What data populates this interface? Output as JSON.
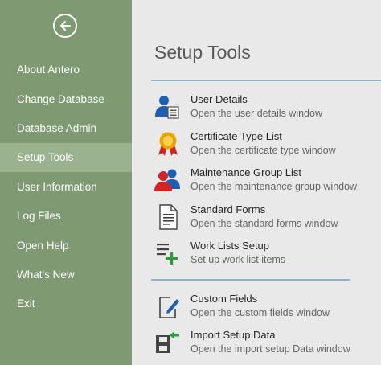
{
  "sidebar": {
    "items": [
      {
        "label": "About Antero"
      },
      {
        "label": "Change Database"
      },
      {
        "label": "Database Admin"
      },
      {
        "label": "Setup Tools"
      },
      {
        "label": "User Information"
      },
      {
        "label": "Log Files"
      },
      {
        "label": "Open Help"
      },
      {
        "label": "What's New"
      },
      {
        "label": "Exit"
      }
    ],
    "selected": "Setup Tools"
  },
  "main": {
    "title": "Setup Tools",
    "tools": [
      {
        "title": "User Details",
        "description": "Open the user details window",
        "icon": "user-details-icon"
      },
      {
        "title": "Certificate Type List",
        "description": "Open the certificate type window",
        "icon": "certificate-icon"
      },
      {
        "title": "Maintenance Group List",
        "description": "Open the maintenance group window",
        "icon": "maintenance-group-icon"
      },
      {
        "title": "Standard Forms",
        "description": "Open the standard forms window",
        "icon": "document-icon"
      },
      {
        "title": "Work Lists Setup",
        "description": "Set up work list items",
        "icon": "work-list-add-icon"
      },
      {
        "title": "Custom Fields",
        "description": "Open the custom fields window",
        "icon": "edit-document-icon"
      },
      {
        "title": "Import Setup Data",
        "description": "Open the import setup Data window",
        "icon": "import-icon"
      }
    ]
  },
  "colors": {
    "sidebar": "#7f9a73",
    "sidebar_selected": "#9bb28f",
    "background": "#e9e9e9",
    "separator": "#8cb4d6",
    "icon_blue": "#1f5fb3",
    "icon_red": "#d32323",
    "icon_green": "#2e9b3a"
  }
}
